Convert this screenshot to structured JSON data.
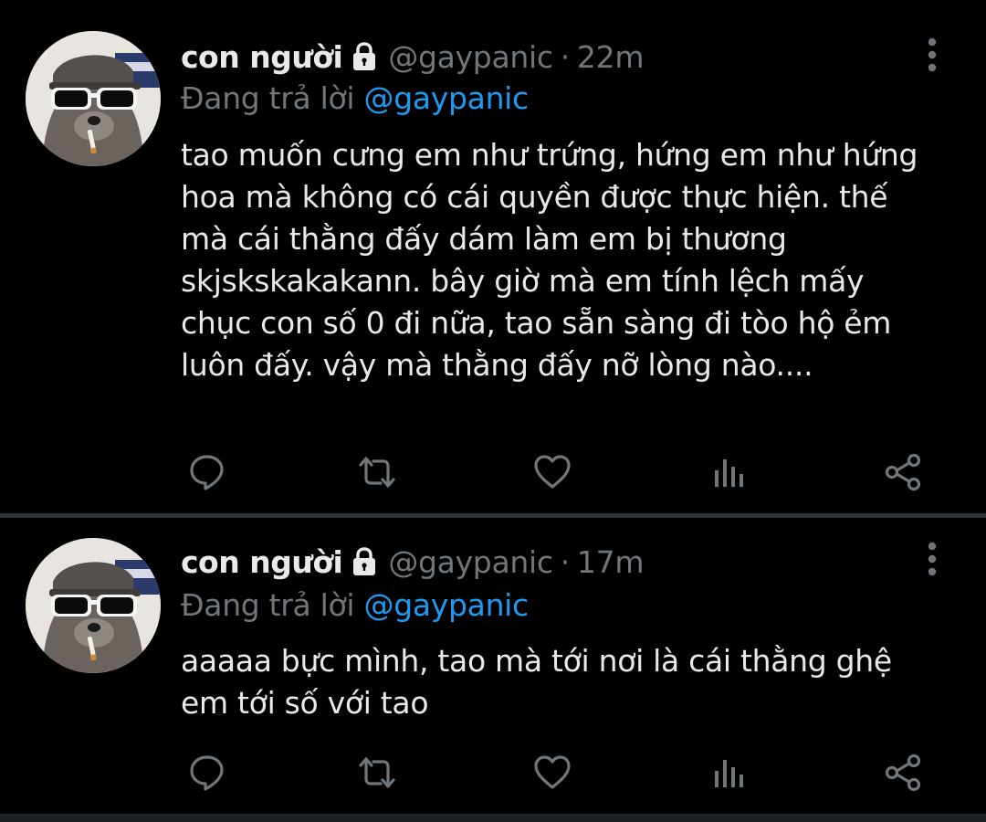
{
  "colors": {
    "background": "#000000",
    "text_primary": "#e7e9ea",
    "text_secondary": "#71767b",
    "link": "#1d9bf0",
    "divider": "#2f3336"
  },
  "tweets": [
    {
      "display_name": "con người",
      "handle": "@gaypanic",
      "separator": "·",
      "time": "22m",
      "reply_prefix": "Đang trả lời",
      "reply_handle": "@gaypanic",
      "text": "tao muốn cưng em như trứng, hứng em như hứng hoa mà không có cái quyền được thực hiện. thế mà cái thằng đấy dám làm em bị thương skjskskakakann. bây giờ mà em tính lệch mấy chục con số 0 đi nữa, tao sẵn sàng đi tòo hộ ẻm luôn đấy. vậy mà thằng đấy nỡ lòng nào....",
      "avatar_icon": "raccoon-with-sunglasses-avatar",
      "lock_icon": "lock-icon",
      "actions": [
        "reply-icon",
        "retweet-icon",
        "like-icon",
        "analytics-icon",
        "share-icon"
      ]
    },
    {
      "display_name": "con người",
      "handle": "@gaypanic",
      "separator": "·",
      "time": "17m",
      "reply_prefix": "Đang trả lời",
      "reply_handle": "@gaypanic",
      "text": "aaaaa bực mình, tao mà tới nơi là cái thằng ghệ em tới số với tao",
      "avatar_icon": "raccoon-with-sunglasses-avatar",
      "lock_icon": "lock-icon",
      "actions": [
        "reply-icon",
        "retweet-icon",
        "like-icon",
        "analytics-icon",
        "share-icon"
      ]
    }
  ]
}
